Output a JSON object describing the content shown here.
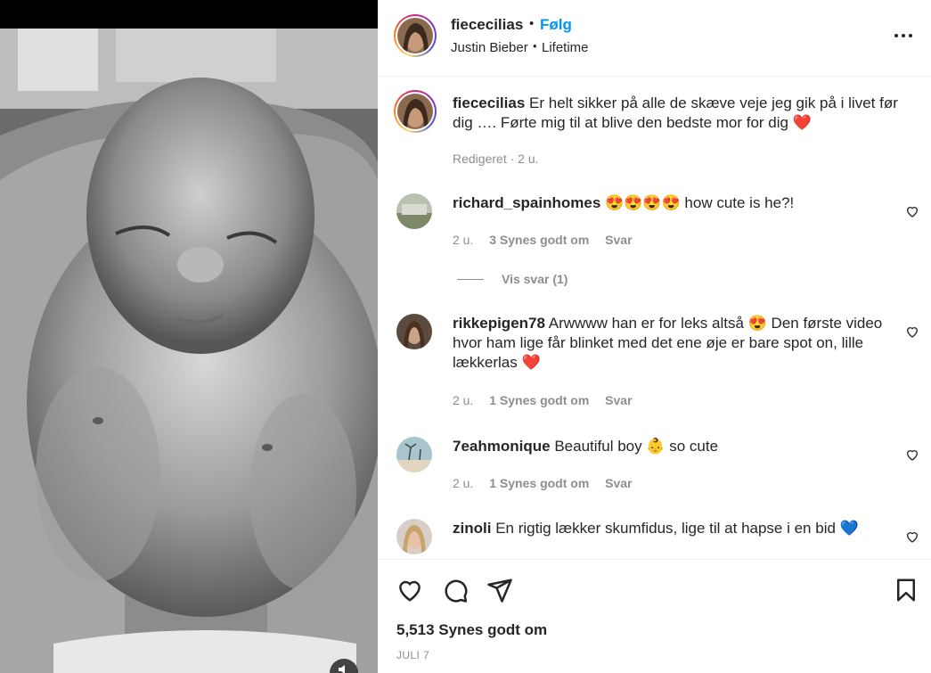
{
  "header": {
    "username": "fiececilias",
    "separator": "•",
    "follow_label": "Følg",
    "audio_artist": "Justin Bieber",
    "audio_separator": "•",
    "audio_title": "Lifetime",
    "more_icon": "more-horizontal-icon"
  },
  "caption": {
    "username": "fiececilias",
    "text": "Er helt sikker på alle de skæve veje jeg gik på i livet før dig …. Førte mig til at blive den bedste mor for dig ❤️",
    "meta": "Redigeret · 2 u."
  },
  "comments": [
    {
      "username": "richard_spainhomes",
      "text": "😍😍😍😍 how cute is he?!",
      "time": "2 u.",
      "likes": "3 Synes godt om",
      "reply": "Svar"
    },
    {
      "username": "rikkepigen78",
      "text": "Arwwww han er for leks altså 😍 Den første video hvor ham lige får blinket med det ene øje er bare spot on, lille lækkerlas ❤️",
      "time": "2 u.",
      "likes": "1 Synes godt om",
      "reply": "Svar"
    },
    {
      "username": "7eahmonique",
      "text": "Beautiful boy 👶 so cute",
      "time": "2 u.",
      "likes": "1 Synes godt om",
      "reply": "Svar"
    },
    {
      "username": "zinoli",
      "text": "En rigtig lækker skumfidus, lige til at hapse i en bid 💙"
    }
  ],
  "view_replies_label": "Vis svar (1)",
  "actions": {
    "like_icon": "heart-icon",
    "comment_icon": "comment-icon",
    "share_icon": "send-icon",
    "save_icon": "bookmark-icon"
  },
  "likes_count": "5,513 Synes godt om",
  "post_date": "JULI 7",
  "colors": {
    "link": "#0095f6",
    "meta": "#8e8e8e",
    "text": "#262626"
  }
}
